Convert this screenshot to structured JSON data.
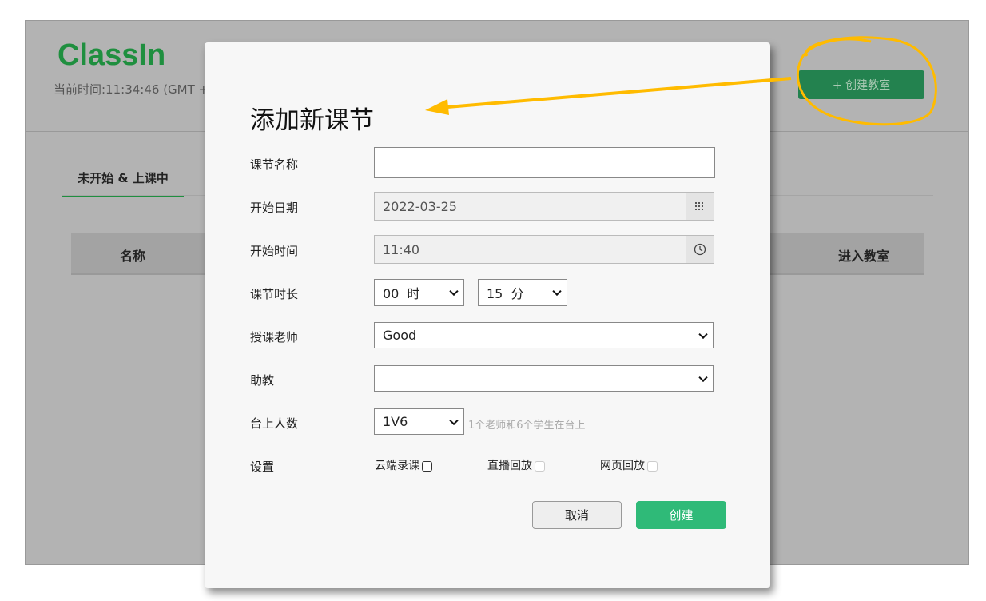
{
  "app": {
    "logo": "ClassIn",
    "current_time": "当前时间:11:34:46 (GMT +",
    "create_room": "+ 创建教室",
    "tab": "未开始 & 上课中",
    "columns": {
      "name": "名称",
      "enter": "进入教室"
    }
  },
  "modal": {
    "title": "添加新课节",
    "fields": {
      "name": {
        "label": "课节名称",
        "value": ""
      },
      "date": {
        "label": "开始日期",
        "value": "2022-03-25",
        "icon": "calendar-icon"
      },
      "time": {
        "label": "开始时间",
        "value": "11:40",
        "icon": "clock-icon"
      },
      "duration": {
        "label": "课节时长",
        "hours": "00  时",
        "minutes": "15  分"
      },
      "teacher": {
        "label": "授课老师",
        "value": "Good"
      },
      "assistant": {
        "label": "助教",
        "value": ""
      },
      "seats": {
        "label": "台上人数",
        "value": "1V6",
        "hint": "1个老师和6个学生在台上"
      },
      "settings": {
        "label": "设置",
        "options": [
          {
            "label": "云端录课",
            "checked": false,
            "enabled": true
          },
          {
            "label": "直播回放",
            "checked": false,
            "enabled": false
          },
          {
            "label": "网页回放",
            "checked": false,
            "enabled": false
          }
        ]
      }
    },
    "cancel": "取消",
    "create": "创建"
  },
  "colors": {
    "brand": "#1f8f3f",
    "primary_button": "#2fba78",
    "annotation": "#ffbb00"
  }
}
